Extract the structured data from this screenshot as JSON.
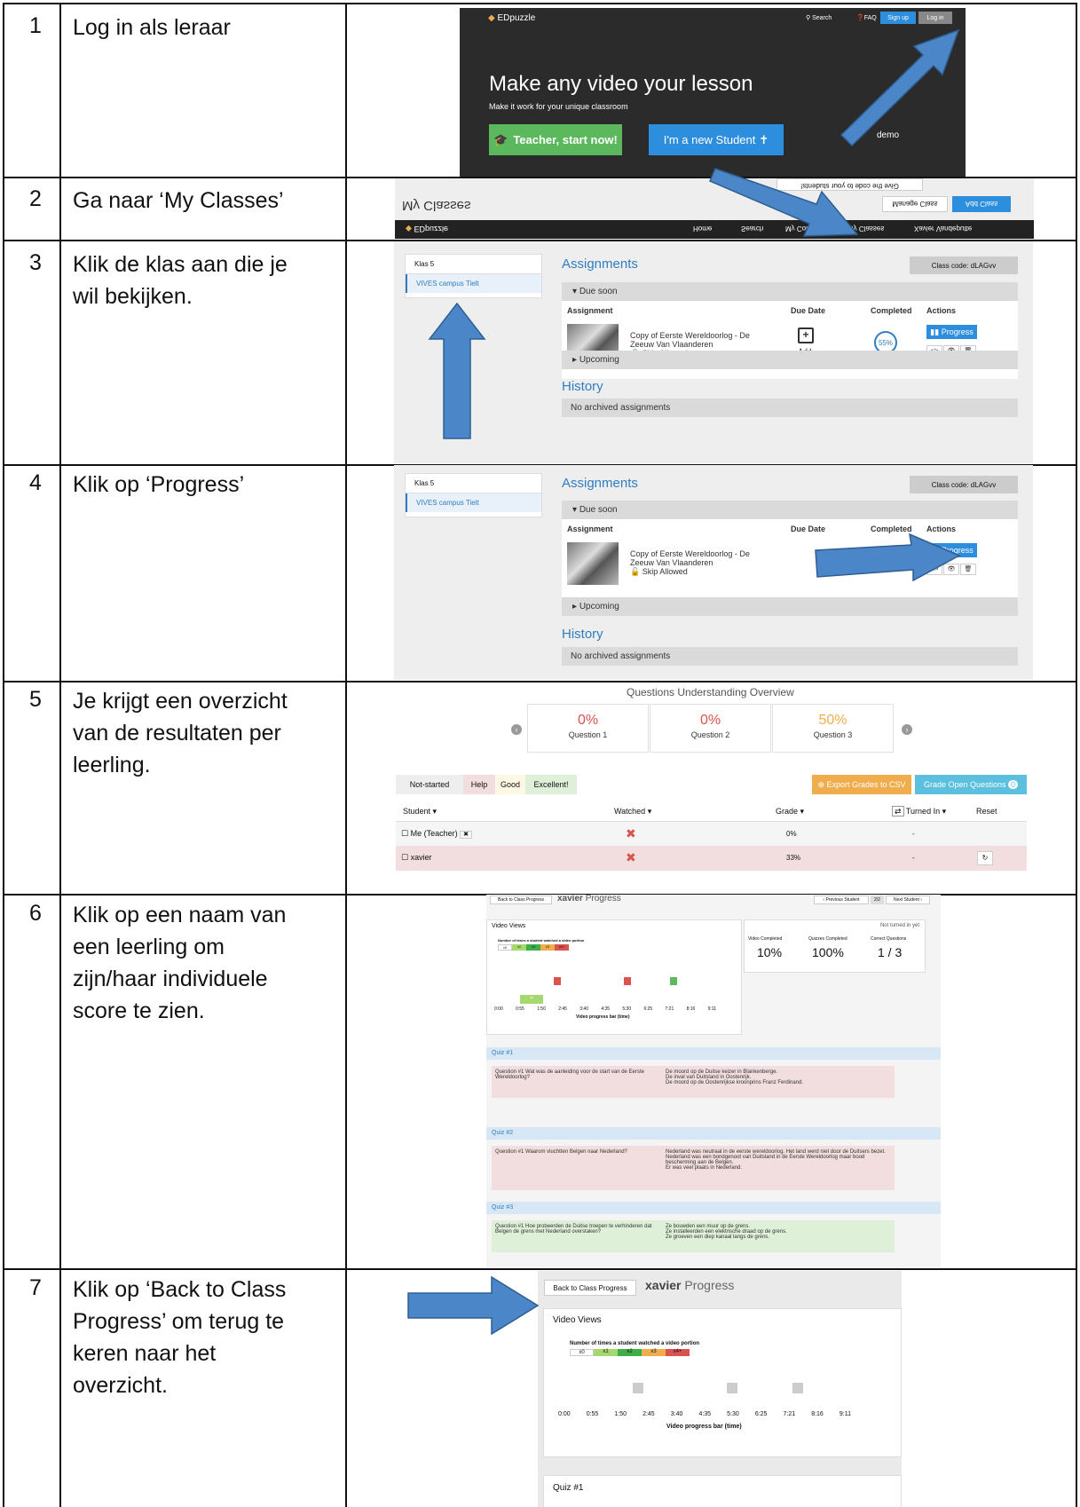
{
  "steps": [
    {
      "num": "1",
      "lines": [
        "Log in als leraar"
      ]
    },
    {
      "num": "2",
      "lines": [
        "Ga naar ‘My Classes’"
      ]
    },
    {
      "num": "3",
      "lines": [
        "Klik de klas aan die je",
        "wil bekijken."
      ]
    },
    {
      "num": "4",
      "lines": [
        "Klik op ‘Progress’"
      ]
    },
    {
      "num": "5",
      "lines": [
        "Je krijgt een overzicht",
        "van de resultaten per",
        "leerling."
      ]
    },
    {
      "num": "6",
      "lines": [
        "Klik op een naam van",
        "een leerling om",
        "zijn/haar individuele",
        "score te zien."
      ]
    },
    {
      "num": "7",
      "lines": [
        "Klik op ‘Back to Class",
        "Progress’ om terug te",
        "keren naar het",
        "overzicht."
      ]
    }
  ],
  "shot1": {
    "brand": "EDpuzzle",
    "nav": {
      "search": "Search",
      "faq": "FAQ",
      "signup": "Sign up",
      "login": "Log in"
    },
    "headline": "Make any video your lesson",
    "subline": "Make it work for your unique classroom",
    "teacher_btn": "Teacher, start now!",
    "student_btn": "I'm a new Student",
    "demo": "demo"
  },
  "shot2": {
    "give_code": "Give the code to your students!",
    "title": "My Classes",
    "manage": "Manage Class",
    "add": "Add Class",
    "brand": "EDpuzzle",
    "nav": [
      "Home",
      "Search",
      "My Content",
      "My Classes",
      "Xavier Vandeputte"
    ]
  },
  "class_panel": {
    "class_name": "Klas 5",
    "campus": "VIVES campus Tielt",
    "assignments": "Assignments",
    "class_code": "Class code: dLAGvv",
    "due_soon": "Due soon",
    "cols": [
      "Assignment",
      "Due Date",
      "Completed",
      "Actions"
    ],
    "assignment_title": "Copy of Eerste Wereldoorlog - De",
    "assignment_title2": "Zeeuw Van Vlaanderen",
    "skip": "Skip Allowed",
    "add": "Add",
    "completed_pct": "55%",
    "progress_btn": "Progress",
    "upcoming": "Upcoming",
    "history": "History",
    "no_archived": "No archived assignments"
  },
  "overview": {
    "title": "Questions Understanding Overview",
    "questions": [
      {
        "pct": "0%",
        "label": "Question 1"
      },
      {
        "pct": "0%",
        "label": "Question 2"
      },
      {
        "pct": "50%",
        "label": "Question 3"
      }
    ],
    "legend": [
      "Not-started",
      "Help",
      "Good",
      "Excellent!"
    ],
    "export_btn": "Export Grades to CSV",
    "grade_btn": "Grade Open Questions",
    "grade_count": "0",
    "cols": [
      "Student",
      "Watched",
      "Grade",
      "Turned In",
      "Reset"
    ],
    "rows": [
      {
        "student": "Me (Teacher)",
        "grade": "0%",
        "turned": "-"
      },
      {
        "student": "xavier",
        "grade": "33%",
        "turned": "-"
      }
    ]
  },
  "progress6": {
    "back": "Back to Class Progress",
    "name": "xavier",
    "progress": "Progress",
    "prev": "‹ Previous Student",
    "page": "2/2",
    "next": "Next Student ›",
    "video_views": "Video Views",
    "not_turned": "Not turned in yet",
    "times_label": "Number of times a student watched a video portion",
    "times_keys": [
      "x0",
      "x1",
      "x2",
      "x3",
      "x4+"
    ],
    "stat_labels": [
      "Video Completed",
      "Quizzes Completed",
      "Correct Questions"
    ],
    "stat_values": [
      "10%",
      "100%",
      "1 / 3"
    ],
    "ticks": [
      "0:00",
      "0:55",
      "1:50",
      "2:45",
      "3:40",
      "4:35",
      "5:30",
      "6:25",
      "7:21",
      "8:16",
      "9:11"
    ],
    "bar_label": "Video progress bar (time)",
    "seg_label": "x1",
    "quiz1": "Quiz #1",
    "q1": "Question #1 Wat was de aanleiding voor de start van de Eerste Wereldoorlog?",
    "q1_opts": [
      "De moord op de Duitse keizer in Blankenberge.",
      "De inval van Duitsland in Oostenrijk.",
      "De moord op de Oostenrijkse kroonprins Franz Ferdinand."
    ],
    "quiz2": "Quiz #2",
    "q2": "Question #1 Waarom vluchtten Belgen naar Nederland?",
    "q2_opts": [
      "Nederland was neutraal in de eerste wereldoorlog. Het land werd niet door de Duitsers bezet.",
      "Nederland was een bondgenoot van Duitsland in de Eerste Wereldoorlog maar bood bescherming aan de Belgen.",
      "Er was veel plaats in Nederland."
    ],
    "quiz3": "Quiz #3",
    "q3": "Question #1 Hoe probeerden de Duitse troepen te verhinderen dat Belgen de grens met Nederland overstaken?",
    "q3_opts": [
      "Ze bouwden een muur op de grens.",
      "Ze installeerden een elektrische draad op de grens.",
      "Ze groeven een diep kanaal langs de grens."
    ]
  },
  "progress7": {
    "back": "Back to Class Progress",
    "name": "xavier",
    "progress": "Progress",
    "video_views": "Video Views",
    "times_label": "Number of times a student watched a video portion",
    "times_keys": [
      "x0",
      "x1",
      "x2",
      "x3",
      "x4+"
    ],
    "ticks": [
      "0:00",
      "0:55",
      "1:50",
      "2:45",
      "3:40",
      "4:35",
      "5:30",
      "6:25",
      "7:21",
      "8:16",
      "9:11"
    ],
    "bar_label": "Video progress bar (time)",
    "quiz1": "Quiz #1"
  },
  "colors": {
    "accent": "#2f7ec1",
    "arrow": "#4a86c8",
    "green": "#5cb85c",
    "red": "#d9534f",
    "orange": "#f0ad4e"
  }
}
